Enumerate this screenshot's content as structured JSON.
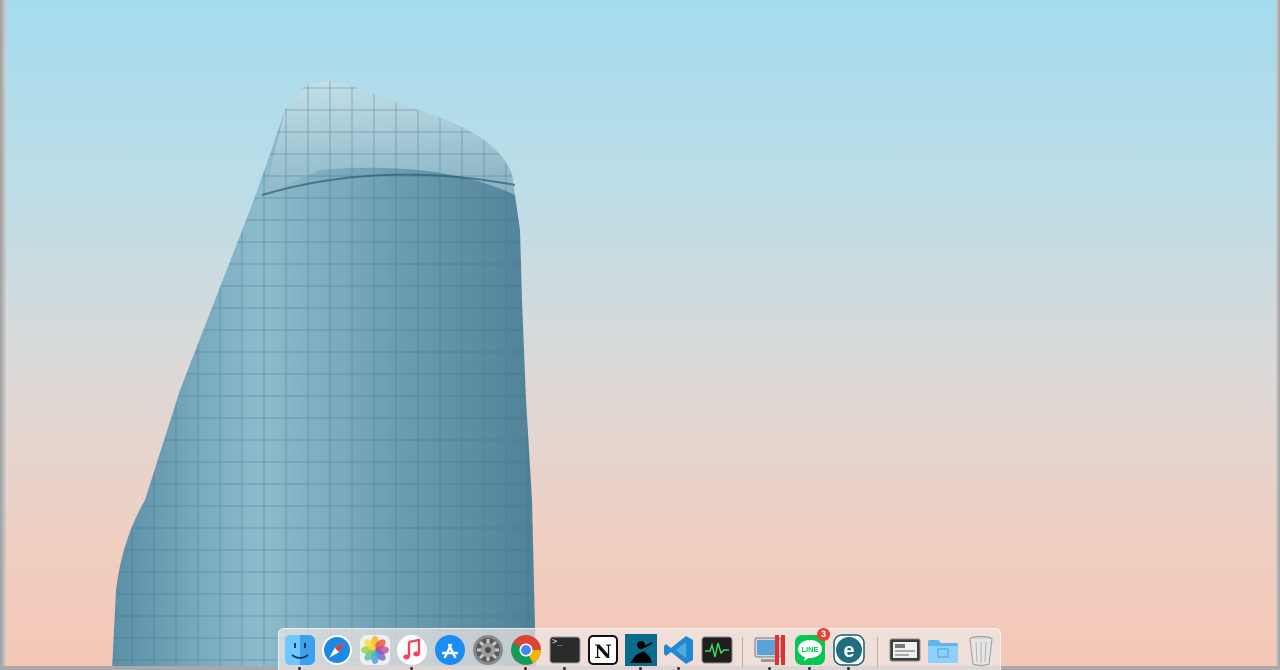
{
  "desktop": {
    "wallpaper": "glass-tower",
    "colors": {
      "sky_top": "#a3dcef",
      "sky_bottom": "#f5c7b6",
      "glass": "#6fa3b8"
    }
  },
  "dock": {
    "items": [
      {
        "id": "finder",
        "icon": "finder-icon",
        "running": true
      },
      {
        "id": "safari",
        "icon": "safari-icon",
        "running": false
      },
      {
        "id": "photos",
        "icon": "photos-icon",
        "running": false
      },
      {
        "id": "music",
        "icon": "music-icon",
        "running": true
      },
      {
        "id": "app-store",
        "icon": "app-store-icon",
        "running": false
      },
      {
        "id": "system-preferences",
        "icon": "gear-icon",
        "running": false
      },
      {
        "id": "chrome",
        "icon": "chrome-icon",
        "running": true
      },
      {
        "id": "terminal",
        "icon": "terminal-icon",
        "running": true,
        "prompt": ">_"
      },
      {
        "id": "notion",
        "icon": "notion-icon",
        "running": false,
        "letter": "N"
      },
      {
        "id": "kindle",
        "icon": "kindle-icon",
        "running": true
      },
      {
        "id": "vscode",
        "icon": "vscode-icon",
        "running": true
      },
      {
        "id": "activity-monitor",
        "icon": "activity-monitor-icon",
        "running": false
      },
      {
        "id": "parallels",
        "icon": "parallels-icon",
        "running": true
      },
      {
        "id": "line",
        "icon": "line-icon",
        "running": true,
        "badge": "3",
        "label": "LINE"
      },
      {
        "id": "eset",
        "icon": "eset-icon",
        "running": true,
        "letter": "e"
      },
      {
        "id": "screenshot",
        "icon": "screenshot-icon",
        "running": false
      },
      {
        "id": "downloads-folder",
        "icon": "folder-icon",
        "running": false
      },
      {
        "id": "trash",
        "icon": "trash-icon",
        "running": false
      }
    ]
  }
}
